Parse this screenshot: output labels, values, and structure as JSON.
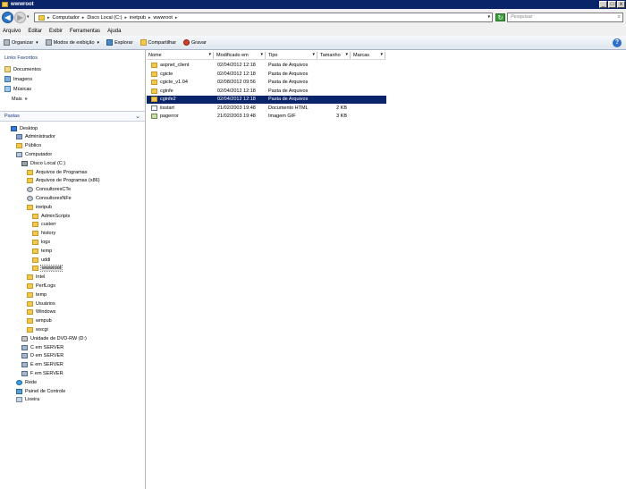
{
  "window": {
    "title": "wwwroot",
    "minimize_label": "_",
    "maximize_label": "□",
    "close_label": "x"
  },
  "address_bar": {
    "back_glyph": "◀",
    "forward_glyph": "▶",
    "crumbs": [
      {
        "label": "Computador"
      },
      {
        "label": "Disco Local (C:)"
      },
      {
        "label": "inetpub"
      },
      {
        "label": "wwwroot"
      }
    ],
    "crumb_separator": "▸",
    "dropdown_glyph": "▾",
    "refresh_glyph": "↻",
    "search_placeholder": "Pesquisar",
    "search_icon_glyph": "⌕"
  },
  "menubar": {
    "items": [
      "Arquivo",
      "Editar",
      "Exibir",
      "Ferramentas",
      "Ajuda"
    ]
  },
  "toolbar": {
    "organize_label": "Organizar",
    "views_label": "Modos de exibição",
    "explore_label": "Explorar",
    "share_label": "Compartilhar",
    "burn_label": "Gravar",
    "dropdown_glyph": "▾",
    "help_glyph": "?"
  },
  "favorites": {
    "title": "Links Favoritos",
    "items": [
      {
        "label": "Documentos",
        "icon": "documents-icon"
      },
      {
        "label": "Imagens",
        "icon": "pictures-icon"
      },
      {
        "label": "Músicas",
        "icon": "music-icon"
      }
    ],
    "more_label": "Mais",
    "more_glyph": "»"
  },
  "folders": {
    "title": "Pastas",
    "collapse_glyph": "⌄",
    "tree": [
      {
        "label": "Desktop",
        "level": 0,
        "icon": "desktop"
      },
      {
        "label": "Administrador",
        "level": 1,
        "icon": "user"
      },
      {
        "label": "Público",
        "level": 1,
        "icon": "folder"
      },
      {
        "label": "Computador",
        "level": 1,
        "icon": "computer"
      },
      {
        "label": "Disco Local (C:)",
        "level": 2,
        "icon": "disk"
      },
      {
        "label": "Arquivos de Programas",
        "level": 3,
        "icon": "folder"
      },
      {
        "label": "Arquivos de Programas (x86)",
        "level": 3,
        "icon": "folder"
      },
      {
        "label": "ConsultoresCTe",
        "level": 3,
        "icon": "gear"
      },
      {
        "label": "ConsultoresNFe",
        "level": 3,
        "icon": "gear"
      },
      {
        "label": "inetpub",
        "level": 3,
        "icon": "folder"
      },
      {
        "label": "AdminScripts",
        "level": 4,
        "icon": "folder"
      },
      {
        "label": "custerr",
        "level": 4,
        "icon": "folder"
      },
      {
        "label": "history",
        "level": 4,
        "icon": "folder"
      },
      {
        "label": "logs",
        "level": 4,
        "icon": "folder"
      },
      {
        "label": "temp",
        "level": 4,
        "icon": "folder"
      },
      {
        "label": "uddi",
        "level": 4,
        "icon": "folder"
      },
      {
        "label": "wwwroot",
        "level": 4,
        "icon": "folder",
        "selected": true
      },
      {
        "label": "Intel",
        "level": 3,
        "icon": "folder"
      },
      {
        "label": "PerfLogs",
        "level": 3,
        "icon": "folder"
      },
      {
        "label": "temp",
        "level": 3,
        "icon": "folder"
      },
      {
        "label": "Usuários",
        "level": 3,
        "icon": "folder"
      },
      {
        "label": "Windows",
        "level": 3,
        "icon": "folder"
      },
      {
        "label": "wmpub",
        "level": 3,
        "icon": "folder"
      },
      {
        "label": "wscgi",
        "level": 3,
        "icon": "folder"
      },
      {
        "label": "Unidade de DVD-RW (D:)",
        "level": 2,
        "icon": "dvd"
      },
      {
        "label": "C em SERVER",
        "level": 2,
        "icon": "netdrive"
      },
      {
        "label": "D em SERVER",
        "level": 2,
        "icon": "netdrive"
      },
      {
        "label": "E em SERVER",
        "level": 2,
        "icon": "netdrive"
      },
      {
        "label": "F em SERVER",
        "level": 2,
        "icon": "netdrive"
      },
      {
        "label": "Rede",
        "level": 1,
        "icon": "network"
      },
      {
        "label": "Painel de Controle",
        "level": 1,
        "icon": "control"
      },
      {
        "label": "Lixeira",
        "level": 1,
        "icon": "trash"
      }
    ]
  },
  "file_list": {
    "columns": [
      {
        "label": "Nome"
      },
      {
        "label": "Modificado em"
      },
      {
        "label": "Tipo"
      },
      {
        "label": "Tamanho"
      },
      {
        "label": "Marcas"
      }
    ],
    "column_dropdown_glyph": "▾",
    "rows": [
      {
        "name": "aspnet_client",
        "modified": "02/04/2012 12:18",
        "type": "Pasta de Arquivos",
        "size": "",
        "icon": "folder"
      },
      {
        "name": "cgicte",
        "modified": "02/04/2012 12:18",
        "type": "Pasta de Arquivos",
        "size": "",
        "icon": "folder"
      },
      {
        "name": "cgicte_v1.04",
        "modified": "02/08/2012 09:56",
        "type": "Pasta de Arquivos",
        "size": "",
        "icon": "folder"
      },
      {
        "name": "cginfe",
        "modified": "02/04/2012 12:18",
        "type": "Pasta de Arquivos",
        "size": "",
        "icon": "folder"
      },
      {
        "name": "cginfe2",
        "modified": "02/04/2012 12:18",
        "type": "Pasta de Arquivos",
        "size": "",
        "icon": "folder",
        "selected": true
      },
      {
        "name": "iisstart",
        "modified": "21/02/2003 19:48",
        "type": "Documento HTML",
        "size": "2 KB",
        "icon": "html"
      },
      {
        "name": "pagerror",
        "modified": "21/02/2003 19:48",
        "type": "Imagem GIF",
        "size": "3 KB",
        "icon": "gif"
      }
    ]
  }
}
